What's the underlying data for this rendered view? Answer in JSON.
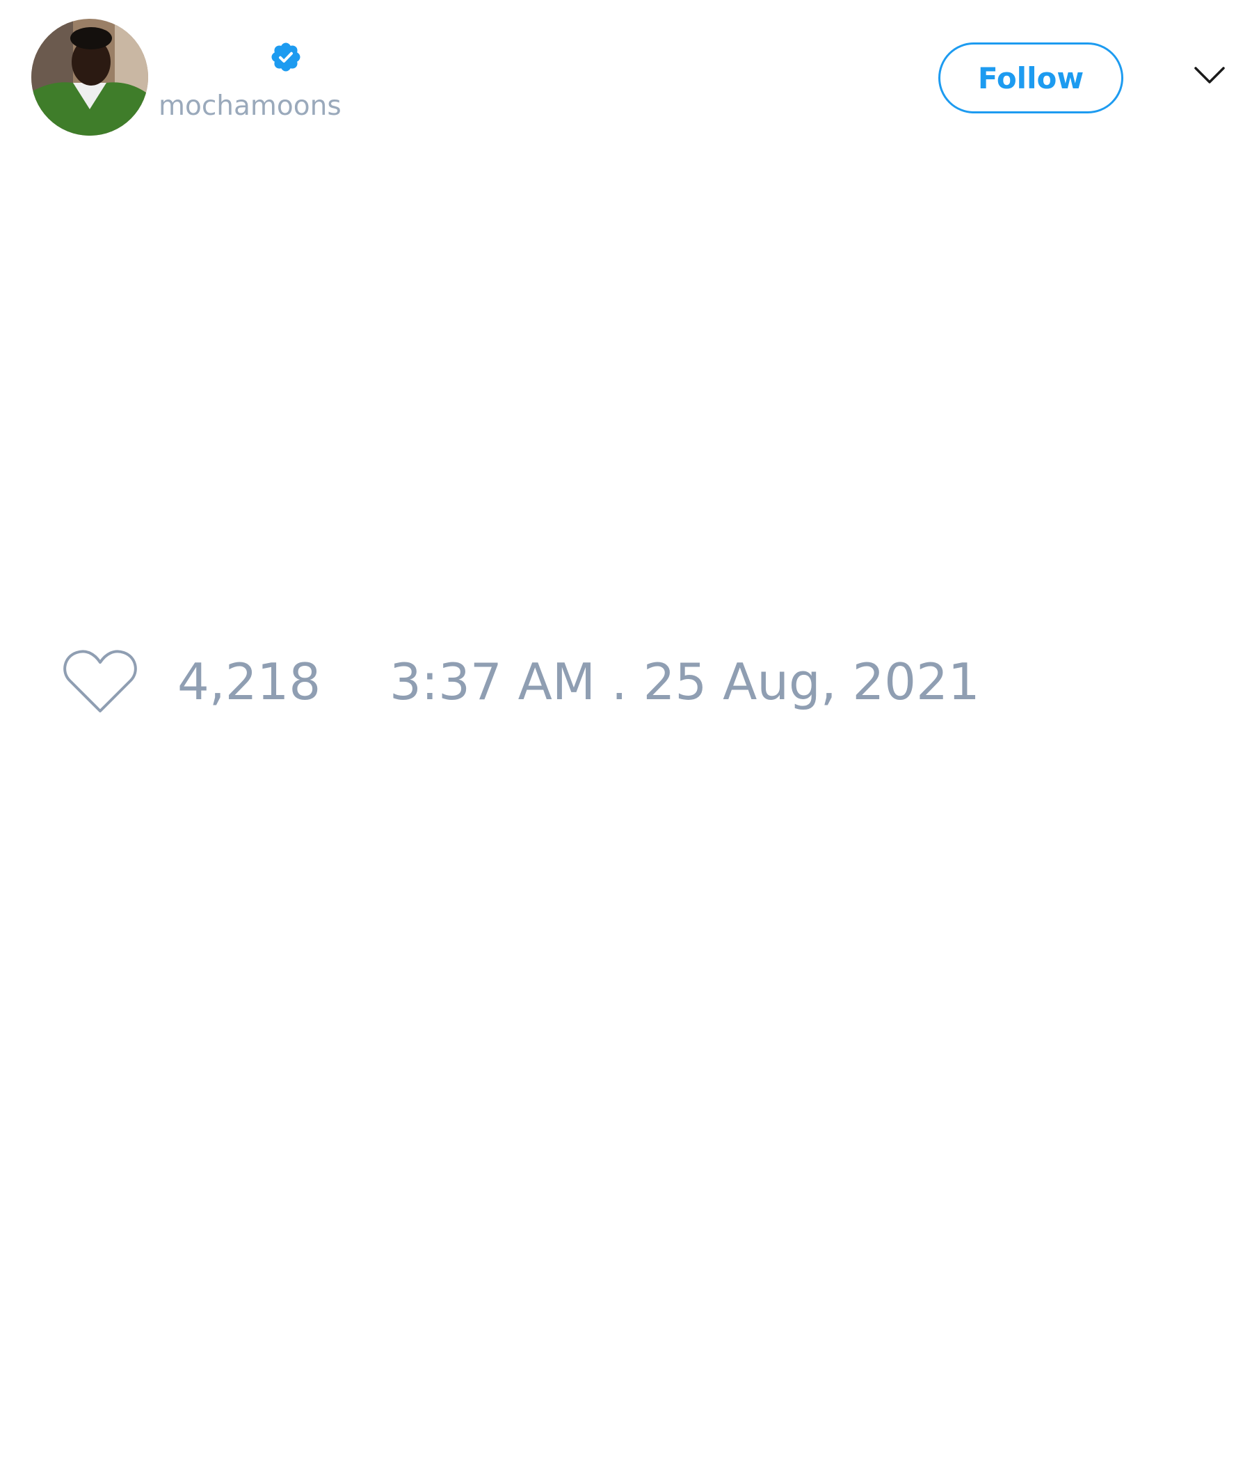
{
  "tweet": {
    "author": {
      "handle": "mochamoons",
      "verified": true,
      "avatar_icon": "user-avatar-photo"
    },
    "follow_label": "Follow",
    "menu_icon": "chevron-down-icon",
    "like_icon": "heart-outline-icon",
    "like_count": "4,218",
    "timestamp": "3:37 AM . 25 Aug, 2021"
  },
  "colors": {
    "accent": "#1d9bf0",
    "muted_text": "#8f9eb2",
    "background": "#ffffff"
  }
}
